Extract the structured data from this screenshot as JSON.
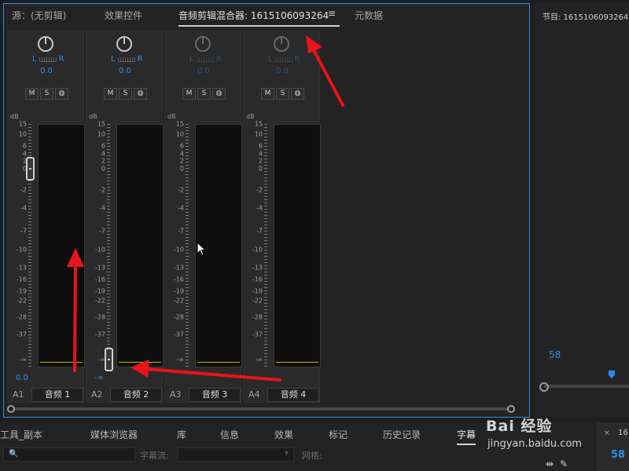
{
  "mixer": {
    "tabs": [
      "源：(无剪辑)",
      "效果控件",
      "音频剪辑混合器: 1615106093264",
      "元数据"
    ],
    "active_tab": 2,
    "tab_menu_glyph": "≡",
    "tracks": [
      {
        "id": "A1",
        "name": "音频 1",
        "pan_l": "L",
        "pan_r": "R",
        "pan_value": "0.0",
        "volume_value": "0.0",
        "fader_db": 0,
        "enabled": true
      },
      {
        "id": "A2",
        "name": "音频 2",
        "pan_l": "L",
        "pan_r": "R",
        "pan_value": "0.0",
        "volume_value": "-∞",
        "fader_db": "-inf",
        "enabled": true
      },
      {
        "id": "A3",
        "name": "音频 3",
        "pan_l": "L",
        "pan_r": "R",
        "pan_value": "0.0",
        "volume_value": "",
        "fader_db": null,
        "enabled": false
      },
      {
        "id": "A4",
        "name": "音频 4",
        "pan_l": "L",
        "pan_r": "R",
        "pan_value": "0.0",
        "volume_value": "",
        "fader_db": null,
        "enabled": false
      }
    ],
    "msr_buttons": [
      "M",
      "S",
      "◍"
    ],
    "db_unit": "dB",
    "db_scale": [
      "15",
      "10",
      "6",
      "4",
      "2",
      "0",
      "-2",
      "-4",
      "-7",
      "-10",
      "-13",
      "-16",
      "-19",
      "-22",
      "-28",
      "-37",
      "-∞"
    ]
  },
  "program": {
    "title": "节目: 1615106093264",
    "timecode": "58"
  },
  "bottom": {
    "tabs": [
      "工具_副本",
      "媒体浏览器",
      "库",
      "信息",
      "效果",
      "标记",
      "历史记录",
      "字幕"
    ],
    "active_tab": 7,
    "search_icon": "🔍",
    "stream_label": "字幕流:",
    "grid_label": "网格:"
  },
  "mini_panel": {
    "close": "×",
    "number": "16",
    "timecode": "58"
  },
  "watermark": {
    "brand": "Bai 经验",
    "url": "jingyan.baidu.com"
  },
  "colors": {
    "accent": "#2d8ceb",
    "annotation": "#e8141b",
    "meter_line": "#c9b200"
  }
}
